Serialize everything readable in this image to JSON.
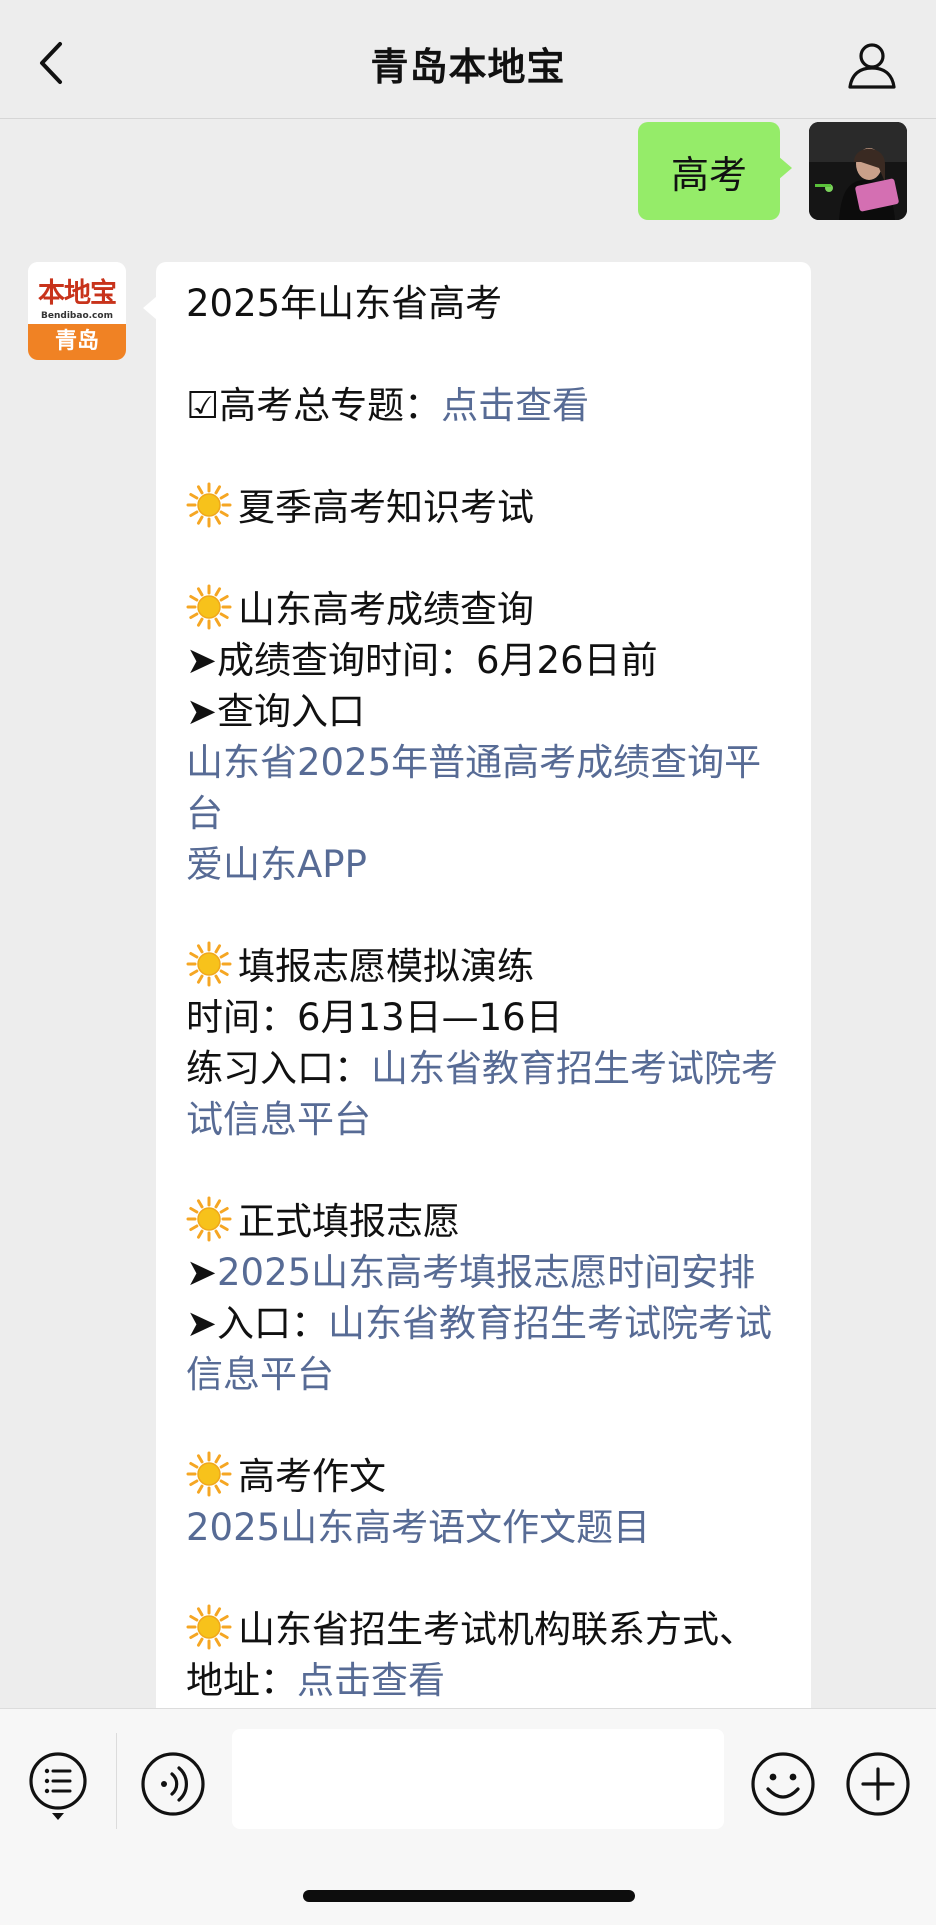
{
  "header": {
    "title": "青岛本地宝"
  },
  "outgoing": {
    "text": "高考"
  },
  "incoming": {
    "avatar": {
      "brand": "本地宝",
      "domain": "Bendibao.com",
      "city": "青岛"
    },
    "lines": [
      {
        "parts": [
          {
            "t": "2025年山东省高考"
          }
        ]
      },
      {
        "blank": true
      },
      {
        "parts": [
          {
            "t": "☑高考总专题："
          },
          {
            "t": "点击查看",
            "link": true
          }
        ]
      },
      {
        "blank": true
      },
      {
        "sun": true,
        "parts": [
          {
            "t": "夏季高考知识考试"
          }
        ]
      },
      {
        "blank": true
      },
      {
        "sun": true,
        "parts": [
          {
            "t": "山东高考成绩查询"
          }
        ]
      },
      {
        "parts": [
          {
            "t": "➤成绩查询时间：6月26日前"
          }
        ]
      },
      {
        "parts": [
          {
            "t": "➤查询入口"
          }
        ]
      },
      {
        "parts": [
          {
            "t": "山东省2025年普通高考成绩查询平台",
            "link": true
          }
        ]
      },
      {
        "parts": [
          {
            "t": "爱山东APP",
            "link": true
          }
        ]
      },
      {
        "blank": true
      },
      {
        "sun": true,
        "parts": [
          {
            "t": "填报志愿模拟演练"
          }
        ]
      },
      {
        "parts": [
          {
            "t": "时间：6月13日—16日"
          }
        ]
      },
      {
        "parts": [
          {
            "t": "练习入口："
          },
          {
            "t": "山东省教育招生考试院考试信息平台",
            "link": true
          }
        ]
      },
      {
        "blank": true
      },
      {
        "sun": true,
        "parts": [
          {
            "t": "正式填报志愿"
          }
        ]
      },
      {
        "parts": [
          {
            "t": "➤"
          },
          {
            "t": "2025山东高考填报志愿时间安排",
            "link": true
          }
        ]
      },
      {
        "parts": [
          {
            "t": "➤入口："
          },
          {
            "t": "山东省教育招生考试院考试信息平台",
            "link": true
          }
        ]
      },
      {
        "blank": true
      },
      {
        "sun": true,
        "parts": [
          {
            "t": "高考作文"
          }
        ]
      },
      {
        "parts": [
          {
            "t": "2025山东高考语文作文题目",
            "link": true
          }
        ]
      },
      {
        "blank": true
      },
      {
        "sun": true,
        "parts": [
          {
            "t": "山东省招生考试机构联系方式、地址："
          },
          {
            "t": "点击查看",
            "link": true
          }
        ]
      }
    ]
  },
  "icons": {
    "back": "chevron-left-icon",
    "profile": "user-icon",
    "menu": "list-menu-icon",
    "voice": "voice-icon",
    "emoji": "smile-icon",
    "plus": "plus-icon",
    "sun": "sun-icon"
  },
  "colors": {
    "background": "#ededed",
    "outgoing_bubble": "#95ec69",
    "incoming_bubble": "#ffffff",
    "link": "#576b95",
    "brand_orange": "#f08224",
    "brand_red": "#c8331b"
  }
}
